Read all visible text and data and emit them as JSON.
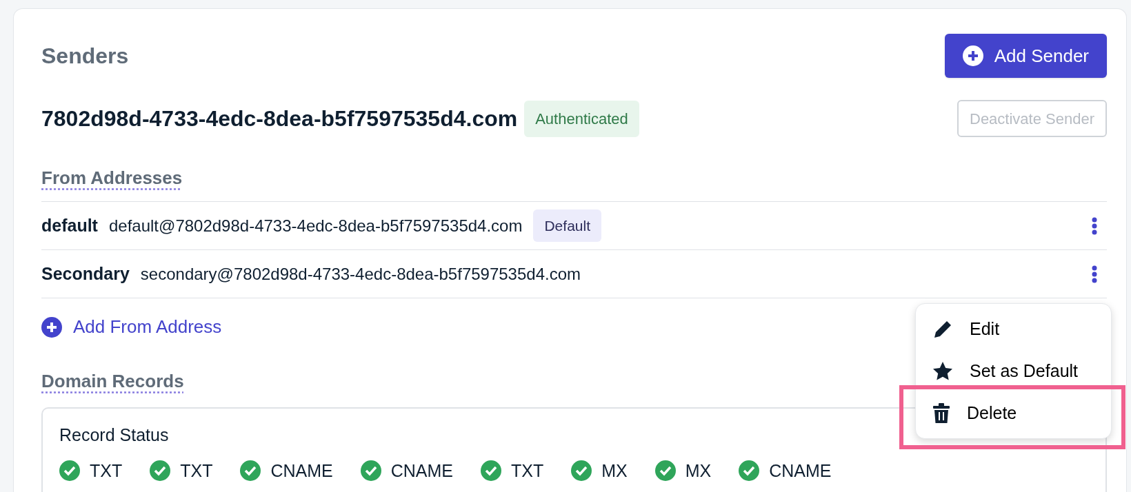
{
  "title": "Senders",
  "add_sender_button": "Add Sender",
  "domain": {
    "name": "7802d98d-4733-4edc-8dea-b5f7597535d4.com",
    "status": "Authenticated"
  },
  "deactivate_button": {
    "label": "Deactivate Sender",
    "disabled": true
  },
  "from_addresses": {
    "heading": "From Addresses",
    "rows": [
      {
        "name": "default",
        "email": "default@7802d98d-4733-4edc-8dea-b5f7597535d4.com",
        "badge": "Default"
      },
      {
        "name": "Secondary",
        "email": "secondary@7802d98d-4733-4edc-8dea-b5f7597535d4.com"
      }
    ],
    "add_link": "Add From Address"
  },
  "domain_records": {
    "heading": "Domain Records",
    "box_title": "Record Status",
    "records": [
      {
        "type": "TXT",
        "verified": true
      },
      {
        "type": "TXT",
        "verified": true
      },
      {
        "type": "CNAME",
        "verified": true
      },
      {
        "type": "CNAME",
        "verified": true
      },
      {
        "type": "TXT",
        "verified": true
      },
      {
        "type": "MX",
        "verified": true
      },
      {
        "type": "MX",
        "verified": true
      },
      {
        "type": "CNAME",
        "verified": true
      }
    ]
  },
  "context_menu": {
    "items": [
      {
        "kind": "edit",
        "label": "Edit",
        "highlighted": false
      },
      {
        "kind": "star",
        "label": "Set as Default",
        "highlighted": false
      },
      {
        "kind": "delete",
        "label": "Delete",
        "highlighted": true
      }
    ]
  }
}
